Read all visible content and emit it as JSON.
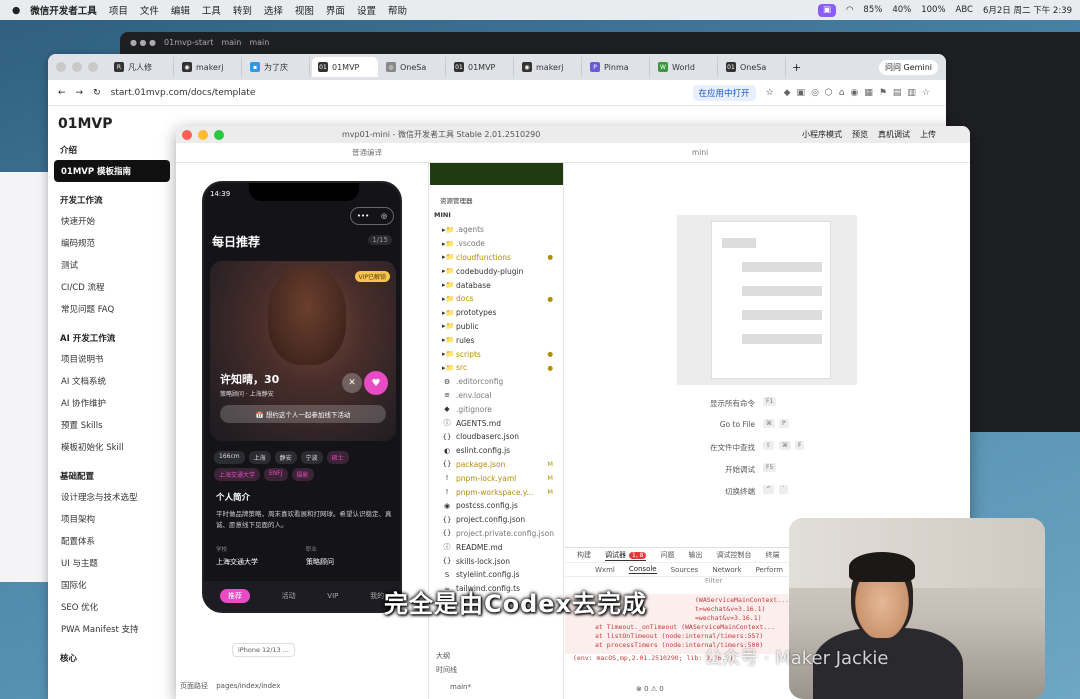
{
  "menubar": {
    "app": "微信开发者工具",
    "items": [
      "项目",
      "文件",
      "编辑",
      "工具",
      "转到",
      "选择",
      "视图",
      "界面",
      "设置",
      "帮助"
    ],
    "status": [
      "85%",
      "40%",
      "100%",
      "ABC",
      "6月2日 周二 下午 2:39"
    ]
  },
  "darkwin": {
    "title": "01mvp-start",
    "branch": "main",
    "branch2": "main"
  },
  "browser": {
    "tabs": [
      "凡人修",
      "makerj",
      "为了庆",
      "01MVP",
      "OneSa",
      "01MVP",
      "makerj",
      "Pinma",
      "World",
      "OneSa"
    ],
    "gemini": "问问 Gemini",
    "url": "start.01mvp.com/docs/template",
    "open_app": "在应用中打开"
  },
  "docs": {
    "logo": "01MVP",
    "intro": "介绍",
    "selected": "01MVP 模板指南",
    "dev_section": "开发工作流",
    "dev_items": [
      "快速开始",
      "编码规范",
      "测试",
      "CI/CD 流程",
      "常见问题 FAQ"
    ],
    "ai_section": "AI 开发工作流",
    "ai_items": [
      "项目说明书",
      "AI 文档系统",
      "AI 协作维护",
      "预置 Skills",
      "模板初始化 Skill"
    ],
    "base_section": "基础配置",
    "base_items": [
      "设计理念与技术选型",
      "项目架构",
      "配置体系",
      "UI 与主题",
      "国际化",
      "SEO 优化",
      "PWA Manifest 支持"
    ],
    "core_section": "核心"
  },
  "devtools": {
    "title": "mvp01-mini - 微信开发者工具 Stable 2.01.2510290",
    "toolbar": [
      "小程序模式",
      "预览",
      "真机调试",
      "上传"
    ],
    "compile": "普通编译",
    "panel_label": "mini"
  },
  "phone": {
    "time": "14:39",
    "title": "每日推荐",
    "count": "1/15",
    "vip": "VIP已解锁",
    "name": "许知晴，30",
    "role": "策略顾问 · 上海静安",
    "meet": "📅 想约这个人一起参加线下活动",
    "tags": [
      "166cm",
      "上海",
      "静安",
      "宁波",
      "硕士",
      "上海交通大学",
      "ENFJ",
      "摄影"
    ],
    "intro_title": "个人简介",
    "intro": "平时做品牌策略，周末喜欢看展和打网球。希望认识稳定、真诚、愿意线下见面的人。",
    "school_label": "学校",
    "school": "上海交通大学",
    "job_label": "职业",
    "job": "策略顾问",
    "nav": [
      "推荐",
      "活动",
      "VIP",
      "我的"
    ],
    "device": "iPhone 12/13 ...",
    "page_path_label": "页面路径",
    "page_path": "pages/index/index"
  },
  "explorer": {
    "title": "资源管理器",
    "root": "MINI",
    "files": [
      {
        "name": ".agents",
        "icon": "▸📁",
        "mod": ""
      },
      {
        "name": ".vscode",
        "icon": "▸📁",
        "mod": ""
      },
      {
        "name": "cloudfunctions",
        "icon": "▸📁",
        "mod": "●"
      },
      {
        "name": "codebuddy-plugin",
        "icon": "▸📁",
        "mod": ""
      },
      {
        "name": "database",
        "icon": "▸📁",
        "mod": ""
      },
      {
        "name": "docs",
        "icon": "▸📁",
        "mod": "●"
      },
      {
        "name": "prototypes",
        "icon": "▸📁",
        "mod": ""
      },
      {
        "name": "public",
        "icon": "▸📁",
        "mod": ""
      },
      {
        "name": "rules",
        "icon": "▸📁",
        "mod": ""
      },
      {
        "name": "scripts",
        "icon": "▸📁",
        "mod": "●"
      },
      {
        "name": "src",
        "icon": "▸📁",
        "mod": "●"
      },
      {
        "name": ".editorconfig",
        "icon": "⚙",
        "mod": ""
      },
      {
        "name": ".env.local",
        "icon": "≡",
        "mod": ""
      },
      {
        "name": ".gitignore",
        "icon": "◆",
        "mod": ""
      },
      {
        "name": "AGENTS.md",
        "icon": "ⓘ",
        "mod": ""
      },
      {
        "name": "cloudbaserc.json",
        "icon": "{}",
        "mod": ""
      },
      {
        "name": "eslint.config.js",
        "icon": "◐",
        "mod": ""
      },
      {
        "name": "package.json",
        "icon": "{}",
        "mod": "M"
      },
      {
        "name": "pnpm-lock.yaml",
        "icon": "!",
        "mod": "M"
      },
      {
        "name": "pnpm-workspace.y...",
        "icon": "!",
        "mod": "M"
      },
      {
        "name": "postcss.config.js",
        "icon": "◉",
        "mod": ""
      },
      {
        "name": "project.config.json",
        "icon": "{}",
        "mod": ""
      },
      {
        "name": "project.private.config.json",
        "icon": "{}",
        "mod": ""
      },
      {
        "name": "README.md",
        "icon": "ⓘ",
        "mod": ""
      },
      {
        "name": "skills-lock.json",
        "icon": "{}",
        "mod": ""
      },
      {
        "name": "stylelint.config.js",
        "icon": "S",
        "mod": ""
      },
      {
        "name": "tailwind.config.ts",
        "icon": "≈",
        "mod": ""
      }
    ],
    "outline": "大纲",
    "timeline": "时间线",
    "branch": "main*",
    "errors": "⊗ 0 ⚠ 0"
  },
  "editor": {
    "commands": [
      {
        "label": "显示所有命令",
        "keys": [
          "F1"
        ]
      },
      {
        "label": "Go to File",
        "keys": [
          "⌘",
          "P"
        ]
      },
      {
        "label": "在文件中查找",
        "keys": [
          "⇧",
          "⌘",
          "F"
        ]
      },
      {
        "label": "开始调试",
        "keys": [
          "F5"
        ]
      },
      {
        "label": "切换终端",
        "keys": [
          "^",
          "`"
        ]
      }
    ]
  },
  "console": {
    "tabs": [
      "构建",
      "调试器",
      "问题",
      "输出",
      "调试控制台",
      "终端"
    ],
    "badge": "1, 8",
    "subtabs": [
      "Wxml",
      "Console",
      "Sources",
      "Network",
      "Perform"
    ],
    "filter": "Filter",
    "lines": [
      "(WAServiceMainContext...",
      "t=wechat&v=3.16.1)",
      "=wechat&v=3.16.1)",
      "at Timeout._onTimeout (WAServiceMainContext...",
      "at listOnTimeout (node:internal/timers:557)",
      "at processTimers (node:internal/timers:500)"
    ],
    "env": "(env: macOS,mp,2.01.2510290; lib: 3.16.1)"
  },
  "overlay": {
    "subtitle": "完全是由Codex去完成",
    "watermark": "公众号 · Maker Jackie"
  },
  "colors": {
    "accent_pink": "#e84cc4",
    "vip_gold": "#f5c451",
    "error_red": "#e03a3a"
  }
}
